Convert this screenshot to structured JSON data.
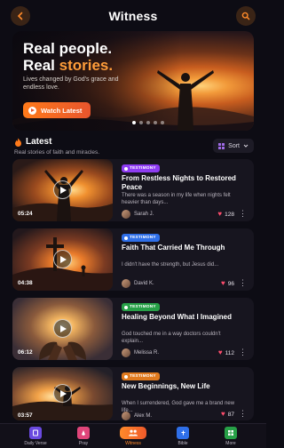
{
  "header": {
    "title": "Witness",
    "back_icon": "chevron-left-icon",
    "search_icon": "search-icon"
  },
  "hero": {
    "line1": "Real people.",
    "line2_a": "Real ",
    "line2_b": "stories.",
    "subtitle": "Lives changed by God's grace and endless love.",
    "cta": "Watch Latest",
    "slides": 5,
    "active_slide": 1,
    "accent_color": "#ff9d3a"
  },
  "latest": {
    "title": "Latest",
    "subtitle": "Real stories of faith and miracles.",
    "sort_label": "Sort"
  },
  "cards": [
    {
      "duration": "05:24",
      "badge": "TESTIMONY",
      "badge_color": "#8e3cf2",
      "title": "From Restless Nights to Restored Peace",
      "desc": "There was a season in my life when nights felt heavier than days...",
      "author": "Sarah J.",
      "likes": "128"
    },
    {
      "duration": "04:38",
      "badge": "TESTIMONY",
      "badge_color": "#2f6fe8",
      "title": "Faith That Carried Me Through",
      "desc": "I didn't have the strength, but Jesus did...",
      "author": "David K.",
      "likes": "96"
    },
    {
      "duration": "06:12",
      "badge": "TESTIMONY",
      "badge_color": "#27a047",
      "title": "Healing Beyond What I Imagined",
      "desc": "God touched me in a way doctors couldn't explain...",
      "author": "Melissa R.",
      "likes": "112"
    },
    {
      "duration": "03:57",
      "badge": "TESTIMONY",
      "badge_color": "#e07a1e",
      "title": "New Beginnings, New Life",
      "desc": "When I surrendered, God gave me a brand new life...",
      "author": "Alex M.",
      "likes": "87"
    }
  ],
  "nav": [
    {
      "label": "Daily Verse",
      "icon": "book-icon",
      "color": "#6a4ae0"
    },
    {
      "label": "Pray",
      "icon": "praying-hands-icon",
      "color": "#e0457a"
    },
    {
      "label": "Witness",
      "icon": "people-icon",
      "color": "#ff8a2a",
      "active": true
    },
    {
      "label": "Bible",
      "icon": "bible-icon",
      "color": "#2f6fe8"
    },
    {
      "label": "More",
      "icon": "grid-icon",
      "color": "#27a047"
    }
  ]
}
